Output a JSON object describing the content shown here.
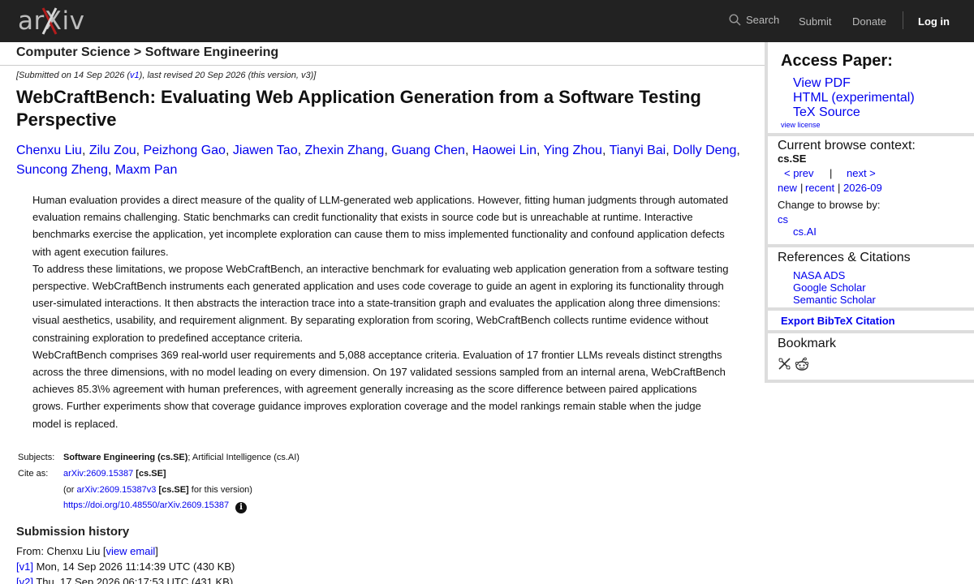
{
  "header": {
    "logo_text": "arXiv",
    "search_label": "Search",
    "submit_label": "Submit",
    "donate_label": "Donate",
    "login_label": "Log in",
    "brand_red": "#b31b1b"
  },
  "breadcrumb": "Computer Science > Software Engineering",
  "paper": {
    "dateline_prefix": "[Submitted on 14 Sep 2026 (",
    "dateline_v1": "v1",
    "dateline_suffix": "), last revised 20 Sep 2026 (this version, v3)]",
    "title": "WebCraftBench: Evaluating Web Application Generation from a Software Testing Perspective",
    "authors": [
      "Chenxu Liu",
      "Zilu Zou",
      "Peizhong Gao",
      "Jiawen Tao",
      "Zhexin Zhang",
      "Guang Chen",
      "Haowei Lin",
      "Ying Zhou",
      "Tianyi Bai",
      "Dolly Deng",
      "Suncong Zheng",
      "Maxm Pan"
    ],
    "abstract": [
      "Human evaluation provides a direct measure of the quality of LLM-generated web applications. However, fitting human judgments through automated evaluation remains challenging. Static benchmarks can credit functionality that exists in source code but is unreachable at runtime. Interactive benchmarks exercise the application, yet incomplete exploration can cause them to miss implemented functionality and confound application defects with agent execution failures.",
      "To address these limitations, we propose WebCraftBench, an interactive benchmark for evaluating web application generation from a software testing perspective. WebCraftBench instruments each generated application and uses code coverage to guide an agent in exploring its functionality through user-simulated interactions. It then abstracts the interaction trace into a state-transition graph and evaluates the application along three dimensions: visual aesthetics, usability, and requirement alignment. By separating exploration from scoring, WebCraftBench collects runtime evidence without constraining exploration to predefined acceptance criteria.",
      "WebCraftBench comprises 369 real-world user requirements and 5,088 acceptance criteria. Evaluation of 17 frontier LLMs reveals distinct strengths across the three dimensions, with no model leading on every dimension. On 197 validated sessions sampled from an internal arena, WebCraftBench achieves 85.3\\% agreement with human preferences, with agreement generally increasing as the score difference between paired applications grows. Further experiments show that coverage guidance improves exploration coverage and the model rankings remain stable when the judge model is replaced."
    ],
    "subjects_label": "Subjects:",
    "subjects_primary": "Software Engineering (cs.SE)",
    "subjects_rest": "; Artificial Intelligence (cs.AI)",
    "cite_label": "Cite as:",
    "cite_id": "arXiv:2609.15387",
    "cite_cat": "[cs.SE]",
    "cite_or_prefix": "(or ",
    "cite_version_id": "arXiv:2609.15387v3",
    "cite_version_cat": "[cs.SE]",
    "cite_version_suffix": " for this version)",
    "doi": "https://doi.org/10.48550/arXiv.2609.15387",
    "info_glyph": "i"
  },
  "history": {
    "title": "Submission history",
    "from_prefix": "From: Chenxu Liu [",
    "view_email": "view email",
    "from_suffix": "]",
    "versions": [
      {
        "tag": "[v1]",
        "date": " Mon, 14 Sep 2026 11:14:39 UTC (430 KB)"
      },
      {
        "tag": "[v2]",
        "date": " Thu, 17 Sep 2026 06:17:53 UTC (431 KB)"
      }
    ]
  },
  "sidebar": {
    "access_title": "Access Paper:",
    "access_links": [
      "View PDF",
      "HTML (experimental)",
      "TeX Source"
    ],
    "view_license": "view license",
    "browse_title": "Current browse context:",
    "browse_context": "cs.SE",
    "prev": "< prev",
    "sep": "|",
    "next": "next >",
    "new": "new",
    "recent": "recent",
    "month": "2026-09",
    "change_label": "Change to browse by:",
    "browse_cs": "cs",
    "browse_csai": "cs.AI",
    "refs_title": "References & Citations",
    "refs_links": [
      "NASA ADS",
      "Google Scholar",
      "Semantic Scholar"
    ],
    "export_bibtex": "Export BibTeX Citation",
    "bookmark_title": "Bookmark",
    "bookmark_icons": [
      "bibsonomy-icon",
      "reddit-icon"
    ]
  }
}
